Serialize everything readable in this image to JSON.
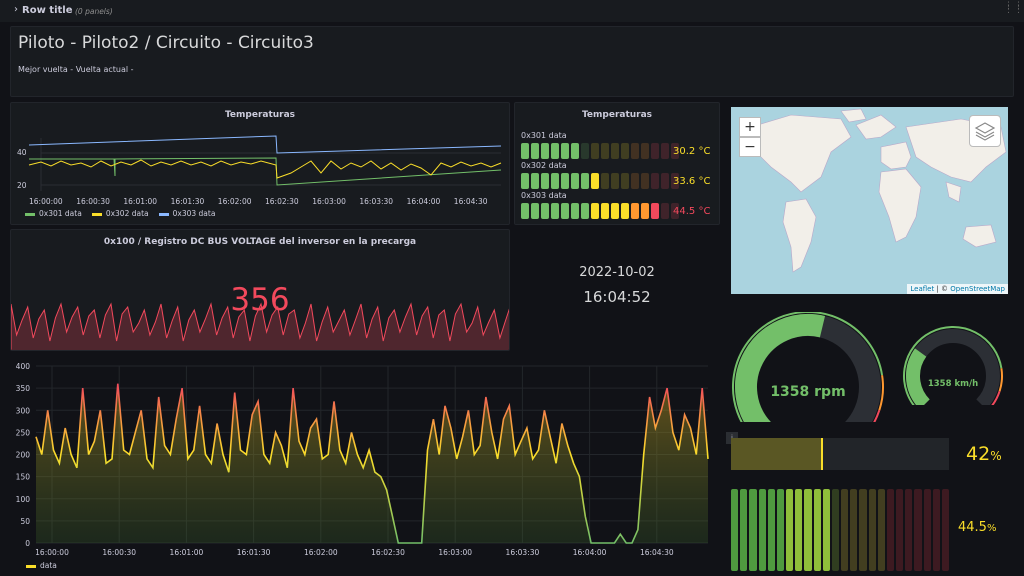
{
  "row": {
    "title": "Row title",
    "panels": "(0 panels)"
  },
  "header": {
    "title": "Piloto - Piloto2 / Circuito - Circuito3",
    "subtitle": "Mejor vuelta - Vuelta actual -"
  },
  "temp_chart": {
    "title": "Temperaturas",
    "y_ticks": [
      "40",
      "20"
    ],
    "x_ticks": [
      "16:00:00",
      "16:00:30",
      "16:01:00",
      "16:01:30",
      "16:02:00",
      "16:02:30",
      "16:03:00",
      "16:03:30",
      "16:04:00",
      "16:04:30"
    ],
    "legend": [
      {
        "name": "0x301 data",
        "color": "#73bf69"
      },
      {
        "name": "0x302 data",
        "color": "#fade2a"
      },
      {
        "name": "0x303 data",
        "color": "#8ab8ff"
      }
    ]
  },
  "temp_bargauge": {
    "title": "Temperaturas",
    "rows": [
      {
        "label": "0x301 data",
        "value": "30.2 °C",
        "level": 0.4,
        "color": "#fade2a"
      },
      {
        "label": "0x302 data",
        "value": "33.6 °C",
        "level": 0.5,
        "color": "#fade2a"
      },
      {
        "label": "0x303 data",
        "value": "44.5 °C",
        "level": 0.9,
        "color": "#f2495c"
      }
    ]
  },
  "dcbus": {
    "title": "0x100 / Registro DC BUS VOLTAGE del inversor en la precarga",
    "value": "356",
    "color": "#f2495c"
  },
  "clock": {
    "date": "2022-10-02",
    "time": "16:04:52"
  },
  "map": {
    "zoom_in": "+",
    "zoom_out": "−",
    "attribution_leaflet": "Leaflet",
    "attribution_sep": " | © ",
    "attribution_osm": "OpenStreetMap"
  },
  "gauge_rpm": {
    "value": "1358 rpm",
    "level": 0.55
  },
  "gauge_kmh": {
    "value": "1358 km/h",
    "level": 0.3
  },
  "bar_percent": {
    "value": "42",
    "unit": "%",
    "level": 0.42,
    "info": "i"
  },
  "led_percent": {
    "value": "44.5",
    "unit": "%",
    "level": 0.445
  },
  "chart_data": {
    "type": "line",
    "y_ticks": [
      "400",
      "350",
      "300",
      "250",
      "200",
      "150",
      "100",
      "50",
      "0"
    ],
    "ylim": [
      0,
      400
    ],
    "x": [
      "16:00:00",
      "16:00:30",
      "16:01:00",
      "16:01:30",
      "16:02:00",
      "16:02:30",
      "16:03:00",
      "16:03:30",
      "16:04:00",
      "16:04:30"
    ],
    "series": [
      {
        "name": "data",
        "color": "#fade2a",
        "values": [
          240,
          200,
          300,
          210,
          180,
          260,
          200,
          170,
          350,
          200,
          230,
          300,
          180,
          190,
          360,
          210,
          200,
          250,
          300,
          190,
          170,
          330,
          220,
          200,
          280,
          350,
          190,
          210,
          310,
          200,
          180,
          270,
          200,
          160,
          340,
          210,
          200,
          290,
          320,
          200,
          180,
          250,
          220,
          170,
          350,
          230,
          200,
          260,
          280,
          190,
          200,
          320,
          210,
          180,
          250,
          200,
          170,
          210,
          160,
          150,
          120,
          60,
          0,
          0,
          0,
          0,
          0,
          210,
          280,
          200,
          310,
          260,
          190,
          240,
          300,
          200,
          220,
          330,
          250,
          190,
          280,
          310,
          200,
          230,
          260,
          190,
          210,
          300,
          240,
          180,
          270,
          220,
          180,
          150,
          60,
          0,
          0,
          0,
          0,
          0,
          20,
          0,
          0,
          30,
          200,
          330,
          260,
          300,
          350,
          250,
          210,
          290,
          260,
          200,
          350,
          190
        ]
      }
    ]
  }
}
